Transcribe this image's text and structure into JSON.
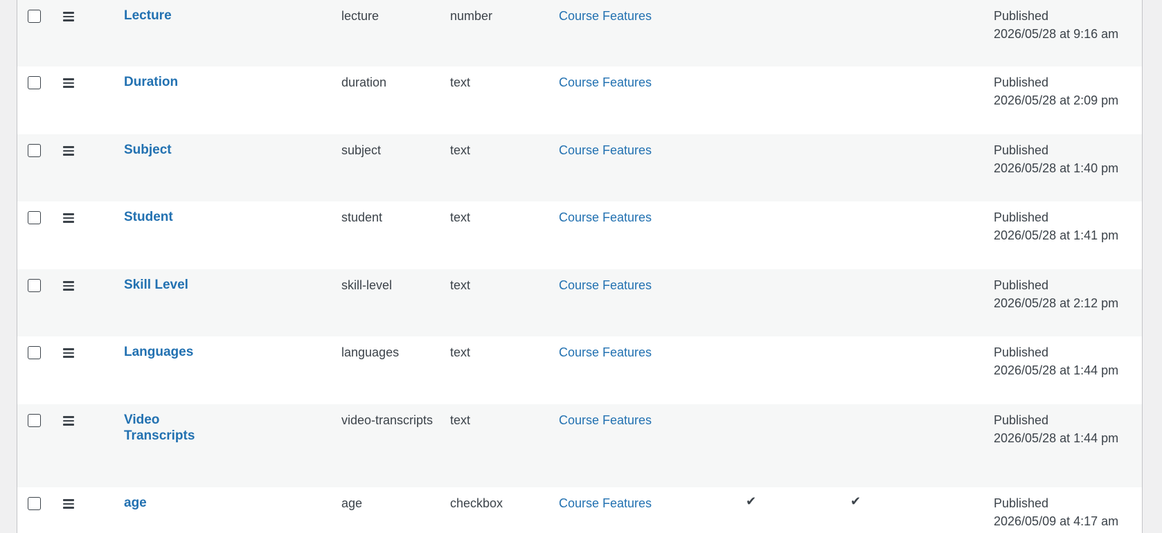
{
  "rows": [
    {
      "title": "Lecture",
      "title_line2": "",
      "slug": "lecture",
      "type": "number",
      "group": "Course Features",
      "col1_check": false,
      "col2_check": false,
      "status": "Published",
      "date": "2026/05/28 at 9:16 am"
    },
    {
      "title": "Duration",
      "title_line2": "",
      "slug": "duration",
      "type": "text",
      "group": "Course Features",
      "col1_check": false,
      "col2_check": false,
      "status": "Published",
      "date": "2026/05/28 at 2:09 pm"
    },
    {
      "title": "Subject",
      "title_line2": "",
      "slug": "subject",
      "type": "text",
      "group": "Course Features",
      "col1_check": false,
      "col2_check": false,
      "status": "Published",
      "date": "2026/05/28 at 1:40 pm"
    },
    {
      "title": "Student",
      "title_line2": "",
      "slug": "student",
      "type": "text",
      "group": "Course Features",
      "col1_check": false,
      "col2_check": false,
      "status": "Published",
      "date": "2026/05/28 at 1:41 pm"
    },
    {
      "title": "Skill Level",
      "title_line2": "",
      "slug": "skill-level",
      "type": "text",
      "group": "Course Features",
      "col1_check": false,
      "col2_check": false,
      "status": "Published",
      "date": "2026/05/28 at 2:12 pm"
    },
    {
      "title": "Languages",
      "title_line2": "",
      "slug": "languages",
      "type": "text",
      "group": "Course Features",
      "col1_check": false,
      "col2_check": false,
      "status": "Published",
      "date": "2026/05/28 at 1:44 pm"
    },
    {
      "title": "Video",
      "title_line2": "Transcripts",
      "slug": "video-transcripts",
      "type": "text",
      "group": "Course Features",
      "col1_check": false,
      "col2_check": false,
      "status": "Published",
      "date": "2026/05/28 at 1:44 pm"
    },
    {
      "title": "age",
      "title_line2": "",
      "slug": "age",
      "type": "checkbox",
      "group": "Course Features",
      "col1_check": true,
      "col2_check": true,
      "status": "Published",
      "date": "2026/05/09 at 4:17 am"
    }
  ],
  "icons": {
    "checkbox": "row-select-checkbox",
    "drag": "drag-handle-icon",
    "check": "checkmark-icon"
  },
  "colors": {
    "link": "#2271b1",
    "text": "#3c434a",
    "alt_row": "#f6f7f7"
  }
}
